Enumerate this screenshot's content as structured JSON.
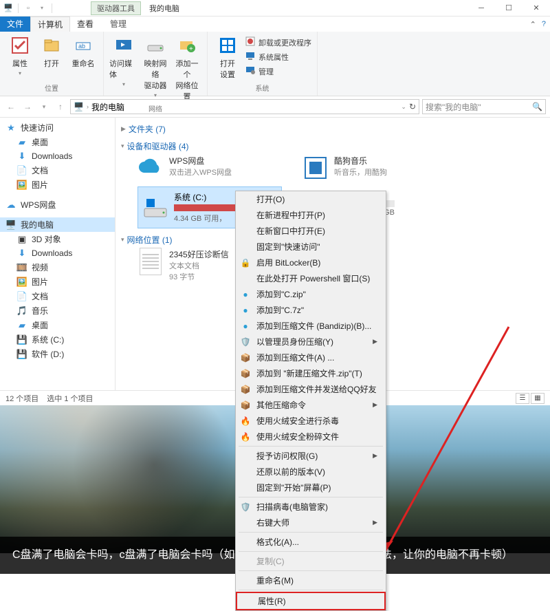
{
  "titlebar": {
    "tool_tab": "驱动器工具",
    "title": "我的电脑"
  },
  "tabs": {
    "file": "文件",
    "computer": "计算机",
    "view": "查看",
    "manage": "管理"
  },
  "ribbon": {
    "location": {
      "prop": "属性",
      "open": "打开",
      "rename": "重命名",
      "label": "位置"
    },
    "network": {
      "media": "访问媒体",
      "map_drive": "映射网络\n驱动器",
      "add_loc": "添加一个\n网络位置",
      "label": "网络"
    },
    "system": {
      "open_settings": "打开\n设置",
      "uninstall": "卸载或更改程序",
      "sysprops": "系统属性",
      "manage": "管理",
      "label": "系统"
    }
  },
  "addressbar": {
    "path_label": "我的电脑",
    "search_placeholder": "搜索\"我的电脑\""
  },
  "sidebar": {
    "quick": "快速访问",
    "desktop": "桌面",
    "downloads": "Downloads",
    "docs": "文档",
    "pics": "图片",
    "wps": "WPS网盘",
    "thispc": "我的电脑",
    "obj3d": "3D 对象",
    "downloads2": "Downloads",
    "video": "视频",
    "pics2": "图片",
    "docs2": "文档",
    "music": "音乐",
    "desktop2": "桌面",
    "sysc": "系统 (C:)",
    "softd": "软件 (D:)"
  },
  "content": {
    "folders_header": "文件夹 (7)",
    "devices_header": "设备和驱动器 (4)",
    "netloc_header": "网络位置 (1)",
    "wps_name": "WPS网盘",
    "wps_sub": "双击进入WPS网盘",
    "kugou_name": "酷狗音乐",
    "kugou_sub": "听音乐，用酷狗",
    "drive_c_name": "系统 (C:)",
    "drive_c_sub": "4.34 GB 可用，",
    "drive_c_free_gb": 4.34,
    "netloc_name": "2345好压诊断信",
    "netloc_type": "文本文档",
    "netloc_size": "93 字节",
    "other_drive_gb": "GB"
  },
  "statusbar": {
    "items": "12 个项目",
    "selected": "选中 1 个项目"
  },
  "context_menu": {
    "open": "打开(O)",
    "open_new_proc": "在新进程中打开(P)",
    "open_new_win": "在新窗口中打开(E)",
    "pin_quick": "固定到\"快速访问\"",
    "bitlocker": "启用 BitLocker(B)",
    "powershell": "在此处打开 Powershell 窗口(S)",
    "add_czip": "添加到\"C.zip\"",
    "add_c7z": "添加到\"C.7z\"",
    "bandizip": "添加到压缩文件 (Bandizip)(B)...",
    "admin_zip": "以管理员身份压缩(Y)",
    "add_zip_a": "添加到压缩文件(A) ...",
    "add_newzip": "添加到 \"新建压缩文件.zip\"(T)",
    "add_zip_qq": "添加到压缩文件并发送给QQ好友",
    "other_zip": "其他压缩命令",
    "huorong_av": "使用火绒安全进行杀毒",
    "huorong_shred": "使用火绒安全粉碎文件",
    "grant_access": "授予访问权限(G)",
    "restore_prev": "还原以前的版本(V)",
    "pin_start": "固定到\"开始\"屏幕(P)",
    "scan_guanjia": "扫描病毒(电脑管家)",
    "rightclick_master": "右键大师",
    "format": "格式化(A)...",
    "copy": "复制(C)",
    "rename": "重命名(M)",
    "properties": "属性(R)"
  },
  "caption": "C盘满了电脑会卡吗，c盘满了电脑会卡吗（如何清理爆满的C盘？教你4个方法，让你的电脑不再卡顿）"
}
